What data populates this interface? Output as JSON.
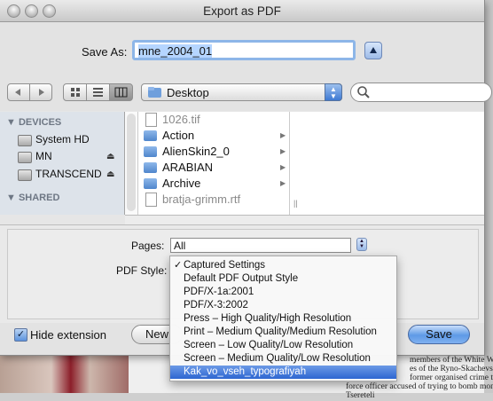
{
  "window": {
    "title": "Export as PDF"
  },
  "save_as": {
    "label": "Save As:",
    "value": "mne_2004_01"
  },
  "toolbar": {
    "location": "Desktop",
    "search_placeholder": ""
  },
  "sidebar": {
    "devices_header": "DEVICES",
    "items": [
      {
        "label": "System HD",
        "eject": false
      },
      {
        "label": "MN",
        "eject": true
      },
      {
        "label": "TRANSCEND",
        "eject": true
      }
    ],
    "shared_header": "SHARED"
  },
  "files": [
    {
      "name": "1026.tif",
      "type": "file",
      "dimmed": true
    },
    {
      "name": "Action",
      "type": "folder",
      "dimmed": false
    },
    {
      "name": "AlienSkin2_0",
      "type": "folder",
      "dimmed": false
    },
    {
      "name": "ARABIAN",
      "type": "folder",
      "dimmed": false
    },
    {
      "name": "Archive",
      "type": "folder",
      "dimmed": false
    },
    {
      "name": "bratja-grimm.rtf",
      "type": "file",
      "dimmed": true
    }
  ],
  "options": {
    "pages_label": "Pages:",
    "pages_value": "All",
    "style_label": "PDF Style:"
  },
  "pdf_style_menu": {
    "items": [
      {
        "label": "Captured Settings",
        "checked": true,
        "selected": false
      },
      {
        "label": "Default PDF Output Style",
        "checked": false,
        "selected": false
      },
      {
        "label": "PDF/X-1a:2001",
        "checked": false,
        "selected": false
      },
      {
        "label": "PDF/X-3:2002",
        "checked": false,
        "selected": false
      },
      {
        "label": "Press – High Quality/High Resolution",
        "checked": false,
        "selected": false
      },
      {
        "label": "Print – Medium Quality/Medium Resolution",
        "checked": false,
        "selected": false
      },
      {
        "label": "Screen – Low Quality/Low Resolution",
        "checked": false,
        "selected": false
      },
      {
        "label": "Screen – Medium Quality/Low Resolution",
        "checked": false,
        "selected": false
      },
      {
        "label": "Kak_vo_vseh_typografiyah",
        "checked": false,
        "selected": true
      }
    ]
  },
  "footer": {
    "hide_extension_label": "Hide extension",
    "hide_extension_checked": true,
    "new_folder_label": "New",
    "save_label": "Save"
  },
  "background_doc": {
    "lines": [
      "members of the White Wolves",
      "es of the Ryno-Skachevsky",
      "former organised crime task",
      "force officer accused of trying to bomb monuments by Georgian sculptor Zurab",
      "Tsereteli"
    ]
  }
}
